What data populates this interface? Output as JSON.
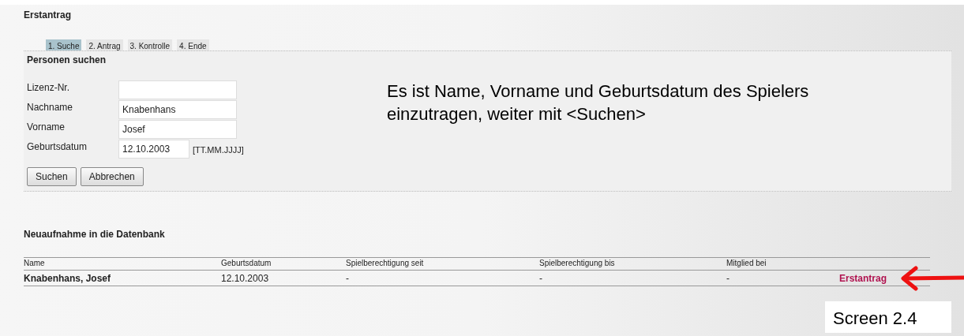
{
  "page_title": "Erstantrag",
  "steps": [
    {
      "label": "1. Suche",
      "selected": true
    },
    {
      "label": "2. Antrag",
      "selected": false
    },
    {
      "label": "3. Kontrolle",
      "selected": false
    },
    {
      "label": "4. Ende",
      "selected": false
    }
  ],
  "search_panel": {
    "title": "Personen suchen",
    "fields": [
      {
        "label": "Lizenz-Nr."
      },
      {
        "label": "Nachname",
        "value": "Knabenhans"
      },
      {
        "label": "Vorname",
        "value": "Josef"
      },
      {
        "label": "Geburtsdatum",
        "value": "12.10.2003",
        "hint": "[TT.MM.JJJJ]"
      }
    ],
    "buttons": [
      "Suchen",
      "Abbrechen"
    ]
  },
  "annotation": "Es ist Name, Vorname und Geburtsdatum des Spielers einzutragen, weiter mit <Suchen>",
  "results": {
    "title": "Neuaufnahme in die Datenbank",
    "columns": [
      "Name",
      "Geburtsdatum",
      "Spielberechtigung seit",
      "Spielberechtigung bis",
      "Mitglied bei"
    ],
    "rows": [
      {
        "cells": [
          "Knabenhans, Josef",
          "12.10.2003",
          "-",
          "-",
          "-"
        ],
        "action": "Erstantrag"
      }
    ]
  },
  "caption": "Screen 2.4"
}
